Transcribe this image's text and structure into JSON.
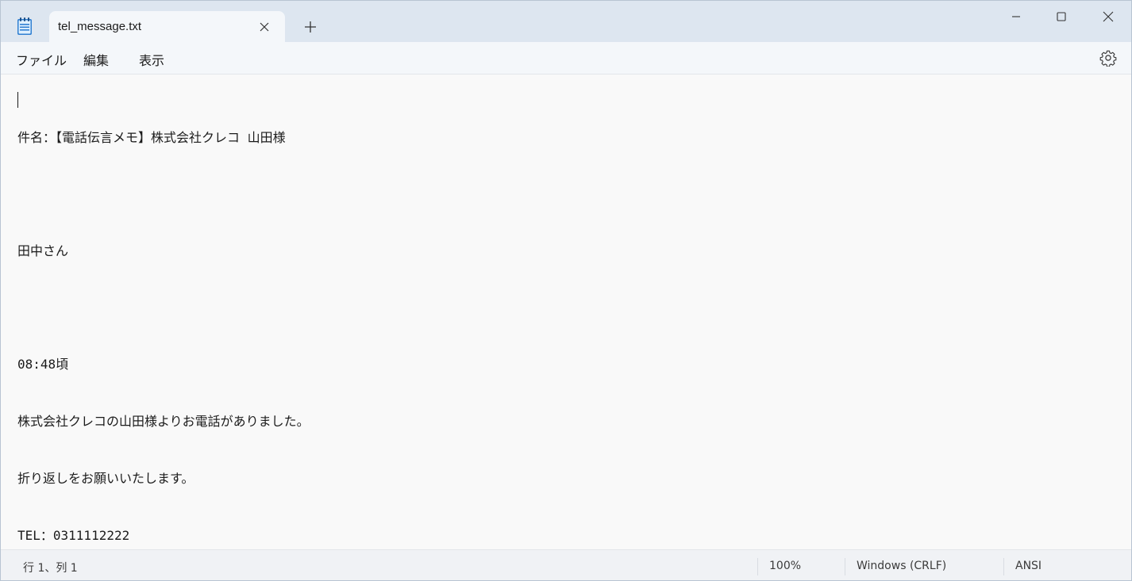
{
  "tab": {
    "title": "tel_message.txt"
  },
  "menu": {
    "file": "ファイル",
    "edit": "編集",
    "view": "表示"
  },
  "document": {
    "lines": [
      "件名：【電話伝言メモ】株式会社クレコ 山田様",
      "",
      "田中さん",
      "",
      "08:48頃",
      "株式会社クレコの山田様よりお電話がありました。",
      "折り返しをお願いいたします。",
      "TEL：0311112222"
    ]
  },
  "status": {
    "position": "行 1、列 1",
    "zoom": "100%",
    "line_ending": "Windows (CRLF)",
    "encoding": "ANSI"
  },
  "icons": {
    "app": "notepad-icon",
    "close_tab": "close-icon",
    "new_tab": "plus-icon",
    "minimize": "minimize-icon",
    "maximize": "maximize-icon",
    "close_window": "close-icon",
    "settings": "gear-icon"
  }
}
